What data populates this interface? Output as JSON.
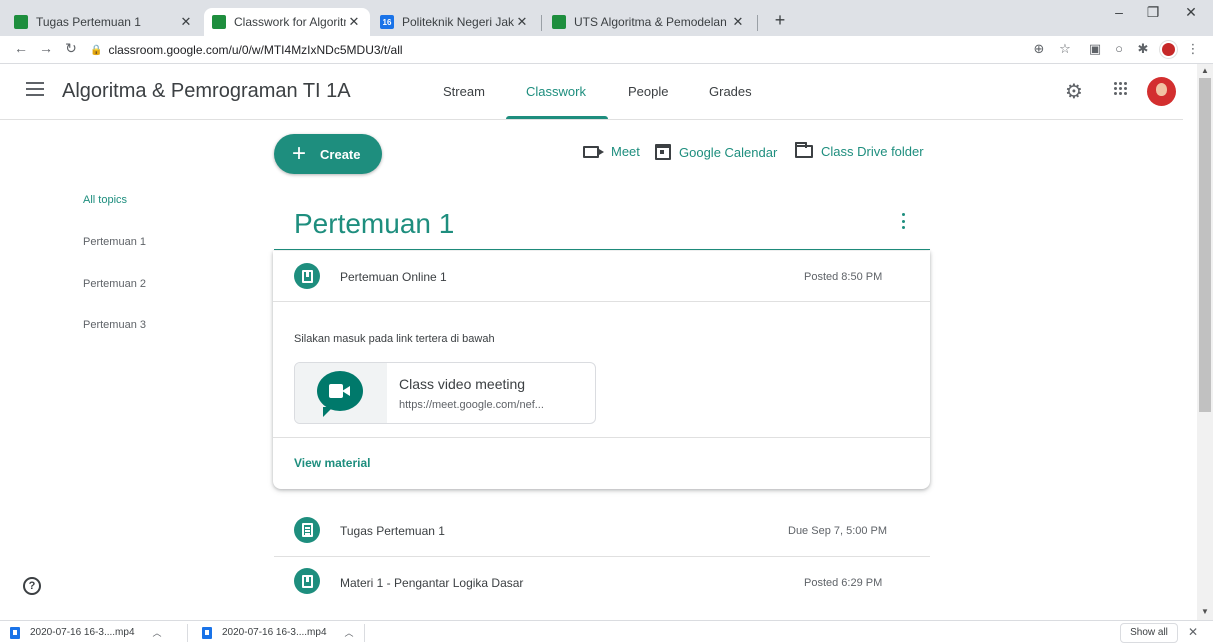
{
  "browser": {
    "tabs": [
      {
        "title": "Tugas Pertemuan 1",
        "favicon": "classroom-favicon",
        "active": false
      },
      {
        "title": "Classwork for Algoritma & Pemro",
        "favicon": "classroom-favicon",
        "active": true
      },
      {
        "title": "Politeknik Negeri Jakarta - Calen",
        "favicon": "calendar-favicon",
        "calendar_day": "16",
        "active": false
      },
      {
        "title": "UTS Algoritma & Pemodelan",
        "favicon": "classroom-favicon",
        "active": false
      }
    ],
    "new_tab_label": "+",
    "url": "classroom.google.com/u/0/w/MTI4MzIxNDc5MDU3/t/all"
  },
  "header": {
    "class_name": "Algoritma & Pemrograman TI 1A",
    "tabs": [
      {
        "label": "Stream",
        "active": false
      },
      {
        "label": "Classwork",
        "active": true
      },
      {
        "label": "People",
        "active": false
      },
      {
        "label": "Grades",
        "active": false
      }
    ]
  },
  "actions": {
    "create_label": "Create",
    "meet_label": "Meet",
    "calendar_label": "Google Calendar",
    "drive_label": "Class Drive folder"
  },
  "topics": [
    {
      "label": "All topics",
      "active": true
    },
    {
      "label": "Pertemuan 1",
      "active": false
    },
    {
      "label": "Pertemuan 2",
      "active": false
    },
    {
      "label": "Pertemuan 3",
      "active": false
    }
  ],
  "section": {
    "title": "Pertemuan 1",
    "expanded_item": {
      "title": "Pertemuan Online 1",
      "meta": "Posted 8:50 PM",
      "icon": "material-icon",
      "description": "Silakan masuk pada link tertera di bawah",
      "attachment": {
        "title": "Class video meeting",
        "url": "https://meet.google.com/nef..."
      },
      "view_label": "View material"
    },
    "items": [
      {
        "title": "Tugas Pertemuan 1",
        "meta": "Due Sep 7, 5:00 PM",
        "icon": "assignment-icon"
      },
      {
        "title": "Materi 1 - Pengantar Logika Dasar",
        "meta": "Posted 6:29 PM",
        "icon": "material-icon"
      }
    ]
  },
  "downloads": [
    {
      "name": "2020-07-16 16-3....mp4"
    },
    {
      "name": "2020-07-16 16-3....mp4"
    }
  ],
  "show_all_label": "Show all",
  "colors": {
    "accent": "#1e8e7e",
    "meet_green": "#00796b"
  }
}
